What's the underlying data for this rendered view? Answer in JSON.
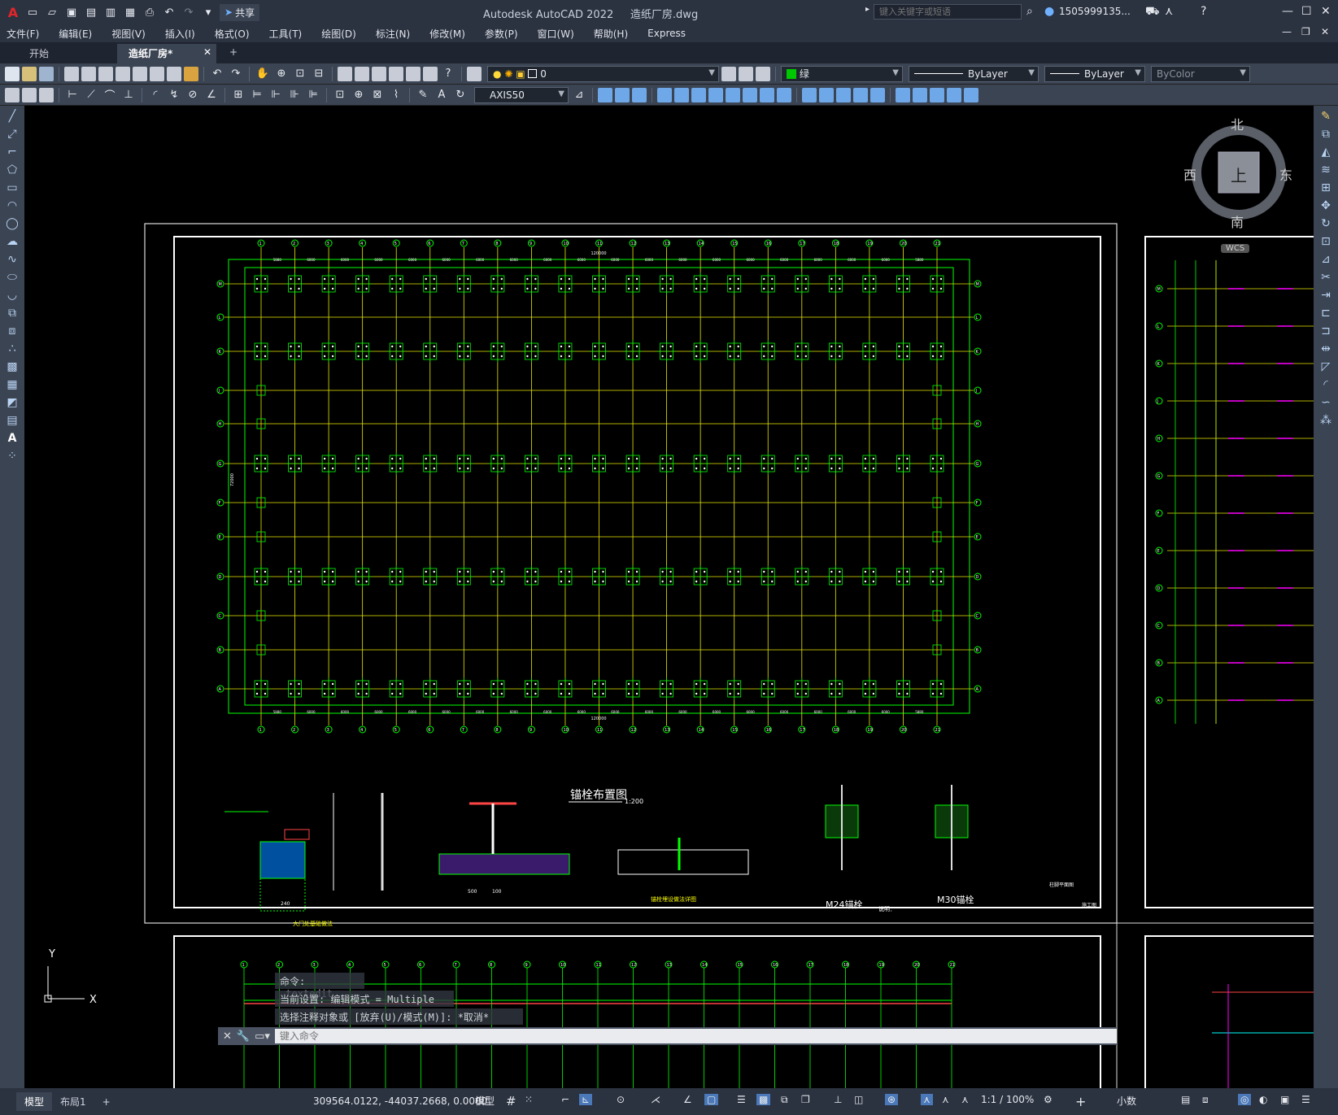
{
  "app": {
    "title": "Autodesk AutoCAD 2022",
    "file": "造纸厂房.dwg"
  },
  "quick_access": {
    "share": "共享"
  },
  "search": {
    "placeholder": "键入关键字或短语"
  },
  "user": {
    "name": "1505999135..."
  },
  "menus": [
    "文件(F)",
    "编辑(E)",
    "视图(V)",
    "插入(I)",
    "格式(O)",
    "工具(T)",
    "绘图(D)",
    "标注(N)",
    "修改(M)",
    "参数(P)",
    "窗口(W)",
    "帮助(H)",
    "Express"
  ],
  "tabs": {
    "start": "开始",
    "active": "造纸厂房*"
  },
  "layer": {
    "name": "0"
  },
  "color": {
    "label": "绿",
    "swatch": "#00c800"
  },
  "linetype": "ByLayer",
  "lineweight": "ByLayer",
  "plotstyle": "ByColor",
  "dimstyle": "AXIS50",
  "navcube": {
    "north": "北",
    "south": "南",
    "east": "东",
    "west": "西",
    "top": "上",
    "wcs": "WCS"
  },
  "drawing": {
    "main_title": "锚栓布置图",
    "scale": "1:200",
    "total_dim": "120000",
    "total_dim_v": "72000",
    "grid_letters": [
      "M",
      "L",
      "K",
      "J",
      "H",
      "G",
      "F",
      "E",
      "D",
      "C",
      "B",
      "A"
    ],
    "grid_numbers": [
      "1",
      "2",
      "3",
      "4",
      "5",
      "6",
      "7",
      "8",
      "9",
      "10",
      "11",
      "12",
      "13",
      "14",
      "15",
      "16",
      "17",
      "18",
      "19",
      "20",
      "21"
    ],
    "bay_dims": [
      "5880",
      "6000",
      "6000",
      "6000",
      "6000",
      "6000",
      "6000",
      "6000",
      "6000",
      "6000",
      "6000",
      "6000",
      "6000",
      "6000",
      "6000",
      "6000",
      "6000",
      "6000",
      "6000",
      "5880"
    ],
    "bolt_m24": "M24锚栓",
    "bolt_m30": "M30锚栓",
    "note_title": "说明：",
    "section_label": "大门处基础做法",
    "detail_label": "锚栓埋设做法详图",
    "stamp": "施工图",
    "axis_label": "柱脚平面图",
    "dim_240": "240",
    "dim_500": "500",
    "dim_100": "100"
  },
  "ucs": {
    "x": "X",
    "y": "Y"
  },
  "command": {
    "line1": "命令: _textedit",
    "line2": "当前设置: 编辑模式 = Multiple",
    "line3": "选择注释对象或 [放弃(U)/模式(M)]: *取消*",
    "input_placeholder": "键入命令"
  },
  "status": {
    "model_tab": "模型",
    "layout_tab": "布局1",
    "coords": "309564.0122, -44037.2668, 0.0000",
    "model": "模型",
    "scale": "1:1 / 100%",
    "units": "小数"
  }
}
